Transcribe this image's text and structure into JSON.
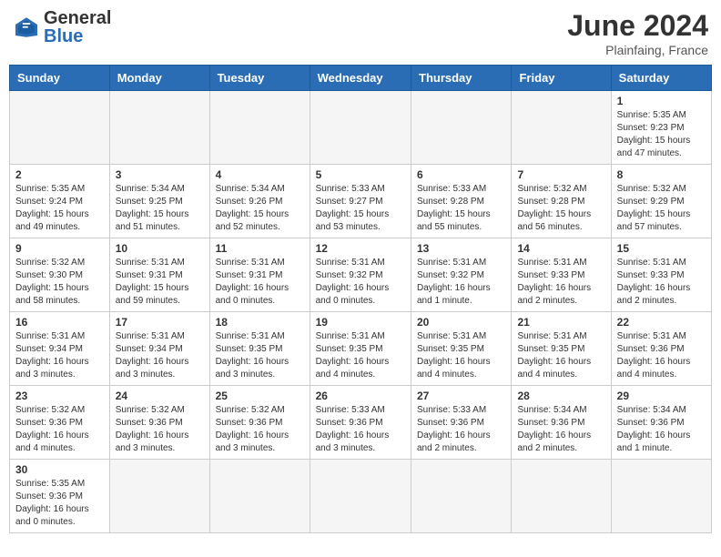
{
  "header": {
    "logo_general": "General",
    "logo_blue": "Blue",
    "month_year": "June 2024",
    "location": "Plainfaing, France"
  },
  "days_of_week": [
    "Sunday",
    "Monday",
    "Tuesday",
    "Wednesday",
    "Thursday",
    "Friday",
    "Saturday"
  ],
  "weeks": [
    [
      {
        "day": null,
        "info": ""
      },
      {
        "day": null,
        "info": ""
      },
      {
        "day": null,
        "info": ""
      },
      {
        "day": null,
        "info": ""
      },
      {
        "day": null,
        "info": ""
      },
      {
        "day": null,
        "info": ""
      },
      {
        "day": "1",
        "info": "Sunrise: 5:35 AM\nSunset: 9:23 PM\nDaylight: 15 hours and 47 minutes."
      }
    ],
    [
      {
        "day": "2",
        "info": "Sunrise: 5:35 AM\nSunset: 9:24 PM\nDaylight: 15 hours and 49 minutes."
      },
      {
        "day": "3",
        "info": "Sunrise: 5:34 AM\nSunset: 9:25 PM\nDaylight: 15 hours and 51 minutes."
      },
      {
        "day": "4",
        "info": "Sunrise: 5:34 AM\nSunset: 9:26 PM\nDaylight: 15 hours and 52 minutes."
      },
      {
        "day": "5",
        "info": "Sunrise: 5:33 AM\nSunset: 9:27 PM\nDaylight: 15 hours and 53 minutes."
      },
      {
        "day": "6",
        "info": "Sunrise: 5:33 AM\nSunset: 9:28 PM\nDaylight: 15 hours and 55 minutes."
      },
      {
        "day": "7",
        "info": "Sunrise: 5:32 AM\nSunset: 9:28 PM\nDaylight: 15 hours and 56 minutes."
      },
      {
        "day": "8",
        "info": "Sunrise: 5:32 AM\nSunset: 9:29 PM\nDaylight: 15 hours and 57 minutes."
      }
    ],
    [
      {
        "day": "9",
        "info": "Sunrise: 5:32 AM\nSunset: 9:30 PM\nDaylight: 15 hours and 58 minutes."
      },
      {
        "day": "10",
        "info": "Sunrise: 5:31 AM\nSunset: 9:31 PM\nDaylight: 15 hours and 59 minutes."
      },
      {
        "day": "11",
        "info": "Sunrise: 5:31 AM\nSunset: 9:31 PM\nDaylight: 16 hours and 0 minutes."
      },
      {
        "day": "12",
        "info": "Sunrise: 5:31 AM\nSunset: 9:32 PM\nDaylight: 16 hours and 0 minutes."
      },
      {
        "day": "13",
        "info": "Sunrise: 5:31 AM\nSunset: 9:32 PM\nDaylight: 16 hours and 1 minute."
      },
      {
        "day": "14",
        "info": "Sunrise: 5:31 AM\nSunset: 9:33 PM\nDaylight: 16 hours and 2 minutes."
      },
      {
        "day": "15",
        "info": "Sunrise: 5:31 AM\nSunset: 9:33 PM\nDaylight: 16 hours and 2 minutes."
      }
    ],
    [
      {
        "day": "16",
        "info": "Sunrise: 5:31 AM\nSunset: 9:34 PM\nDaylight: 16 hours and 3 minutes."
      },
      {
        "day": "17",
        "info": "Sunrise: 5:31 AM\nSunset: 9:34 PM\nDaylight: 16 hours and 3 minutes."
      },
      {
        "day": "18",
        "info": "Sunrise: 5:31 AM\nSunset: 9:35 PM\nDaylight: 16 hours and 3 minutes."
      },
      {
        "day": "19",
        "info": "Sunrise: 5:31 AM\nSunset: 9:35 PM\nDaylight: 16 hours and 4 minutes."
      },
      {
        "day": "20",
        "info": "Sunrise: 5:31 AM\nSunset: 9:35 PM\nDaylight: 16 hours and 4 minutes."
      },
      {
        "day": "21",
        "info": "Sunrise: 5:31 AM\nSunset: 9:35 PM\nDaylight: 16 hours and 4 minutes."
      },
      {
        "day": "22",
        "info": "Sunrise: 5:31 AM\nSunset: 9:36 PM\nDaylight: 16 hours and 4 minutes."
      }
    ],
    [
      {
        "day": "23",
        "info": "Sunrise: 5:32 AM\nSunset: 9:36 PM\nDaylight: 16 hours and 4 minutes."
      },
      {
        "day": "24",
        "info": "Sunrise: 5:32 AM\nSunset: 9:36 PM\nDaylight: 16 hours and 3 minutes."
      },
      {
        "day": "25",
        "info": "Sunrise: 5:32 AM\nSunset: 9:36 PM\nDaylight: 16 hours and 3 minutes."
      },
      {
        "day": "26",
        "info": "Sunrise: 5:33 AM\nSunset: 9:36 PM\nDaylight: 16 hours and 3 minutes."
      },
      {
        "day": "27",
        "info": "Sunrise: 5:33 AM\nSunset: 9:36 PM\nDaylight: 16 hours and 2 minutes."
      },
      {
        "day": "28",
        "info": "Sunrise: 5:34 AM\nSunset: 9:36 PM\nDaylight: 16 hours and 2 minutes."
      },
      {
        "day": "29",
        "info": "Sunrise: 5:34 AM\nSunset: 9:36 PM\nDaylight: 16 hours and 1 minute."
      }
    ],
    [
      {
        "day": "30",
        "info": "Sunrise: 5:35 AM\nSunset: 9:36 PM\nDaylight: 16 hours and 0 minutes."
      },
      {
        "day": null,
        "info": ""
      },
      {
        "day": null,
        "info": ""
      },
      {
        "day": null,
        "info": ""
      },
      {
        "day": null,
        "info": ""
      },
      {
        "day": null,
        "info": ""
      },
      {
        "day": null,
        "info": ""
      }
    ]
  ]
}
